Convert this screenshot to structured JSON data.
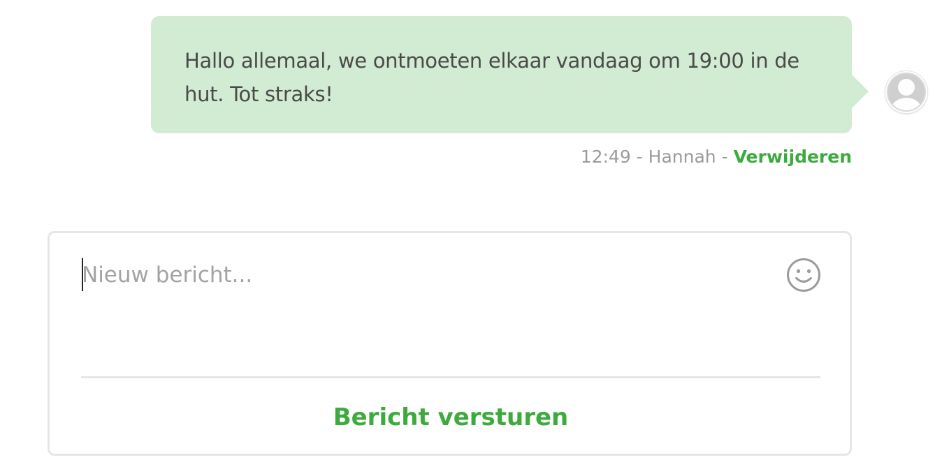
{
  "message": {
    "text": "Hallo allemaal, we ontmoeten elkaar vandaag om 19:00 in de hut. Tot straks!",
    "time": "12:49",
    "separator": " - ",
    "author": "Hannah",
    "delete_label": "Verwijderen",
    "bubble_color": "#d2ebd3"
  },
  "avatar": {
    "icon": "user-avatar-icon"
  },
  "composer": {
    "placeholder": "Nieuw bericht...",
    "value": "",
    "emoji_icon": "smiley-icon",
    "send_label": "Bericht versturen",
    "accent_color": "#3daa3e"
  }
}
